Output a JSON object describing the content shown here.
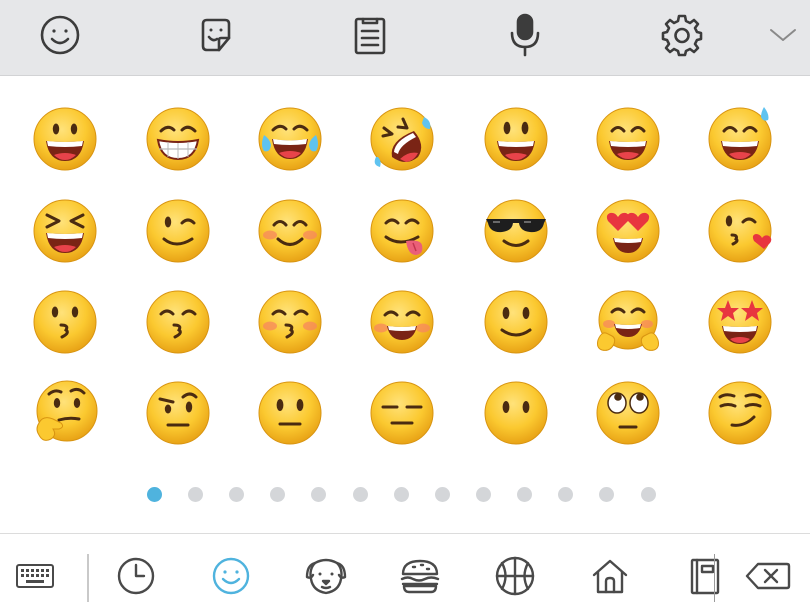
{
  "colors": {
    "toolbar_bg": "#e6e7e9",
    "icon": "#3c3c3c",
    "accent": "#4fb3de",
    "dot_inactive": "#d4d6d9",
    "emoji_face": "#f8c12e"
  },
  "top_toolbar": {
    "icons": [
      "smiley-icon",
      "sticker-icon",
      "clipboard-icon",
      "microphone-icon",
      "gear-icon",
      "chevron-down-icon"
    ]
  },
  "emoji_grid": {
    "rows": [
      [
        "grinning-face",
        "beaming-face",
        "face-with-tears-of-joy",
        "rolling-on-floor-laughing",
        "grinning-face-big-eyes",
        "grinning-face-smiling-eyes",
        "grinning-face-with-sweat"
      ],
      [
        "squinting-face",
        "winking-face",
        "smiling-face-smiling-eyes",
        "face-savoring-food",
        "smiling-face-with-sunglasses",
        "smiling-face-with-heart-eyes",
        "face-blowing-a-kiss"
      ],
      [
        "kissing-face",
        "kissing-face-smiling-eyes",
        "kissing-face-closed-eyes",
        "smiling-face",
        "slightly-smiling-face",
        "hugging-face",
        "star-struck"
      ],
      [
        "thinking-face",
        "face-with-raised-eyebrow",
        "neutral-face",
        "expressionless-face",
        "face-without-mouth",
        "face-with-rolling-eyes",
        "smirking-face"
      ]
    ]
  },
  "pagination": {
    "total_pages": 13,
    "current_page": 1
  },
  "bottom_toolbar": {
    "icons": [
      "keyboard-icon",
      "recent-clock-icon",
      "smileys-category-icon",
      "animals-dog-icon",
      "food-burger-icon",
      "activity-basketball-icon",
      "places-house-icon",
      "objects-notebook-icon",
      "backspace-icon"
    ],
    "active": "smileys-category-icon"
  }
}
